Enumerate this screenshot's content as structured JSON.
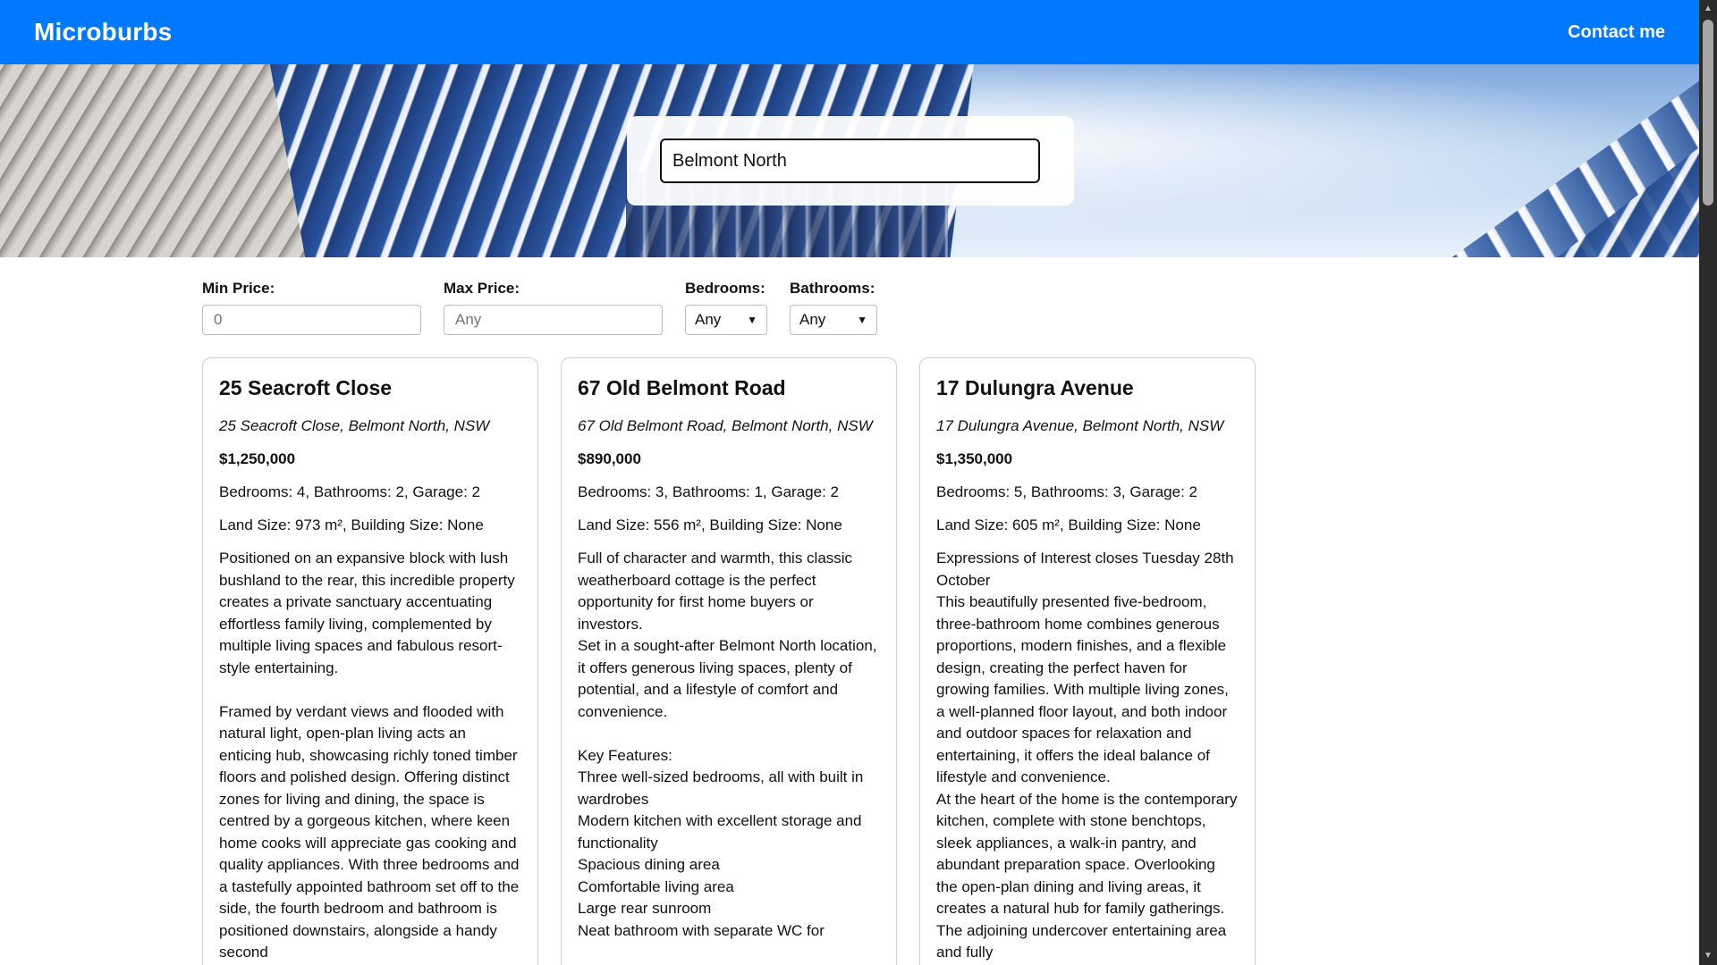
{
  "header": {
    "brand": "Microburbs",
    "contact_label": "Contact me"
  },
  "search": {
    "value": "Belmont North"
  },
  "filters": {
    "min_price": {
      "label": "Min Price:",
      "placeholder": "0"
    },
    "max_price": {
      "label": "Max Price:",
      "placeholder": "Any"
    },
    "bedrooms": {
      "label": "Bedrooms:",
      "selected": "Any"
    },
    "bathrooms": {
      "label": "Bathrooms:",
      "selected": "Any"
    }
  },
  "listings": [
    {
      "title": "25 Seacroft Close",
      "address": "25 Seacroft Close, Belmont North, NSW",
      "price": "$1,250,000",
      "rooms": "Bedrooms: 4, Bathrooms: 2, Garage: 2",
      "size": "Land Size: 973 m², Building Size: None",
      "description": "Positioned on an expansive block with lush bushland to the rear, this incredible property creates a private sanctuary accentuating effortless family living, complemented by multiple living spaces and fabulous resort-style entertaining.\n\nFramed by verdant views and flooded with natural light, open-plan living acts an enticing hub, showcasing richly toned timber floors and polished design. Offering distinct zones for living and dining, the space is centred by a gorgeous kitchen, where keen home cooks will appreciate gas cooking and quality appliances. With three bedrooms and a tastefully appointed bathroom set off to the side, the fourth bedroom and bathroom is positioned downstairs, alongside a handy second"
    },
    {
      "title": "67 Old Belmont Road",
      "address": "67 Old Belmont Road, Belmont North, NSW",
      "price": "$890,000",
      "rooms": "Bedrooms: 3, Bathrooms: 1, Garage: 2",
      "size": "Land Size: 556 m², Building Size: None",
      "description": "Full of character and warmth, this classic weatherboard cottage is the perfect opportunity for first home buyers or investors.\nSet in a sought-after Belmont North location, it offers generous living spaces, plenty of potential, and a lifestyle of comfort and convenience.\n\nKey Features:\nThree well-sized bedrooms, all with built in wardrobes\nModern kitchen with excellent storage and functionality\nSpacious dining area\nComfortable living area\nLarge rear sunroom\nNeat bathroom with separate WC for"
    },
    {
      "title": "17 Dulungra Avenue",
      "address": "17 Dulungra Avenue, Belmont North, NSW",
      "price": "$1,350,000",
      "rooms": "Bedrooms: 5, Bathrooms: 3, Garage: 2",
      "size": "Land Size: 605 m², Building Size: None",
      "description": "Expressions of Interest closes Tuesday 28th October\nThis beautifully presented five-bedroom, three-bathroom home combines generous proportions, modern finishes, and a flexible design, creating the perfect haven for growing families. With multiple living zones, a well-planned floor layout, and both indoor and outdoor spaces for relaxation and entertaining, it offers the ideal balance of lifestyle and convenience.\nAt the heart of the home is the contemporary kitchen, complete with stone benchtops, sleek appliances, a walk-in pantry, and abundant preparation space. Overlooking the open-plan dining and living areas, it creates a natural hub for family gatherings. The adjoining undercover entertaining area and fully"
    }
  ]
}
